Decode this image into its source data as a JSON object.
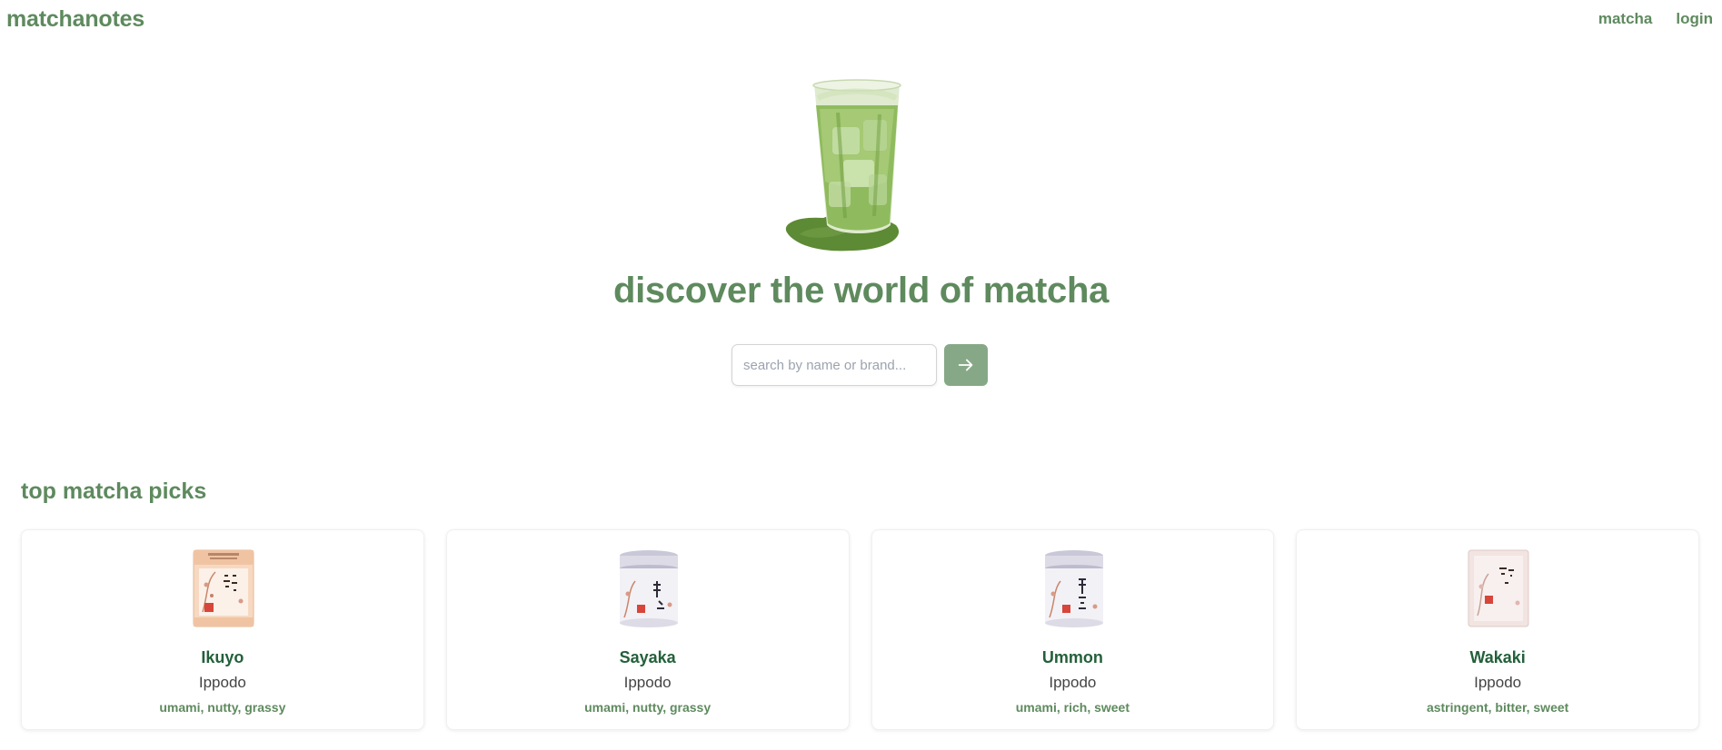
{
  "nav": {
    "logo": "matchanotes",
    "links": [
      "matcha",
      "login"
    ]
  },
  "hero": {
    "image_icon": "iced-matcha-glass-illustration",
    "title": "discover the world of matcha"
  },
  "search": {
    "placeholder": "search by name or brand...",
    "value": "",
    "button_icon": "arrow-right-icon"
  },
  "section": {
    "title": "top matcha picks"
  },
  "cards": [
    {
      "name": "Ikuyo",
      "brand": "Ippodo",
      "notes": "umami, nutty, grassy",
      "image_icon": "matcha-box-image"
    },
    {
      "name": "Sayaka",
      "brand": "Ippodo",
      "notes": "umami, nutty, grassy",
      "image_icon": "matcha-tin-image"
    },
    {
      "name": "Ummon",
      "brand": "Ippodo",
      "notes": "umami, rich, sweet",
      "image_icon": "matcha-tin-image"
    },
    {
      "name": "Wakaki",
      "brand": "Ippodo",
      "notes": "astringent, bitter, sweet",
      "image_icon": "matcha-box-image"
    }
  ],
  "colors": {
    "brand_green": "#5e8a5e",
    "button_green": "#87a887",
    "card_name_green": "#23603a"
  }
}
